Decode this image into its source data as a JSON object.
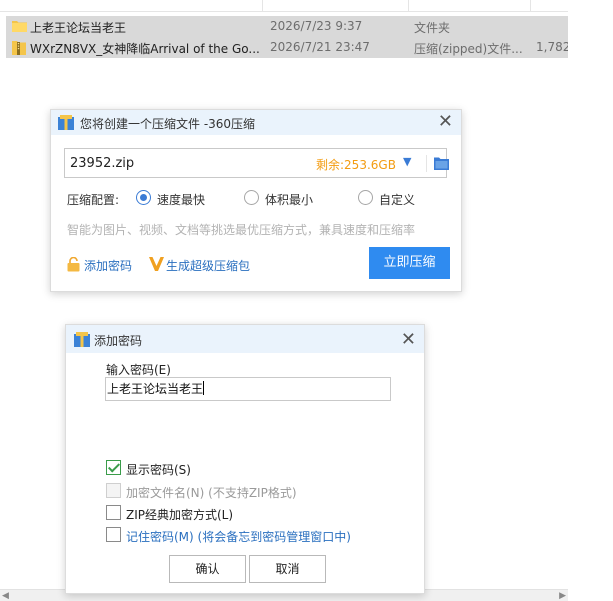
{
  "explorer": {
    "rows": [
      {
        "name": "上老王论坛当老王",
        "date": "2026/7/23 9:37",
        "type": "文件夹",
        "size": ""
      },
      {
        "name": "WXrZN8VX_女神降临Arrival of the Go...",
        "date": "2026/7/21 23:47",
        "type": "压缩(zipped)文件...",
        "size": "1,782"
      }
    ]
  },
  "dialog360": {
    "title": "您将创建一个压缩文件 -360压缩",
    "filename": "23952.zip",
    "remaining": "剩余:253.6GB",
    "config_label": "压缩配置:",
    "options": [
      {
        "label": "速度最快",
        "selected": true
      },
      {
        "label": "体积最小",
        "selected": false
      },
      {
        "label": "自定义",
        "selected": false
      }
    ],
    "hint": "智能为图片、视频、文档等挑选最优压缩方式，兼具速度和压缩率",
    "add_password": "添加密码",
    "super_pack": "生成超级压缩包",
    "compress_button": "立即压缩",
    "accent_color": "#2f8bf0"
  },
  "password_dialog": {
    "title": "添加密码",
    "input_label": "输入密码(E)",
    "password_value": "上老王论坛当老王",
    "checkboxes": [
      {
        "label": "显示密码(S)",
        "checked": true,
        "disabled": false
      },
      {
        "label": "加密文件名(N) (不支持ZIP格式)",
        "checked": false,
        "disabled": true
      },
      {
        "label": "ZIP经典加密方式(L)",
        "checked": false,
        "disabled": false
      },
      {
        "label": "记住密码(M) (将会备忘到密码管理窗口中)",
        "checked": false,
        "disabled": false
      }
    ],
    "ok_button": "确认",
    "cancel_button": "取消"
  }
}
